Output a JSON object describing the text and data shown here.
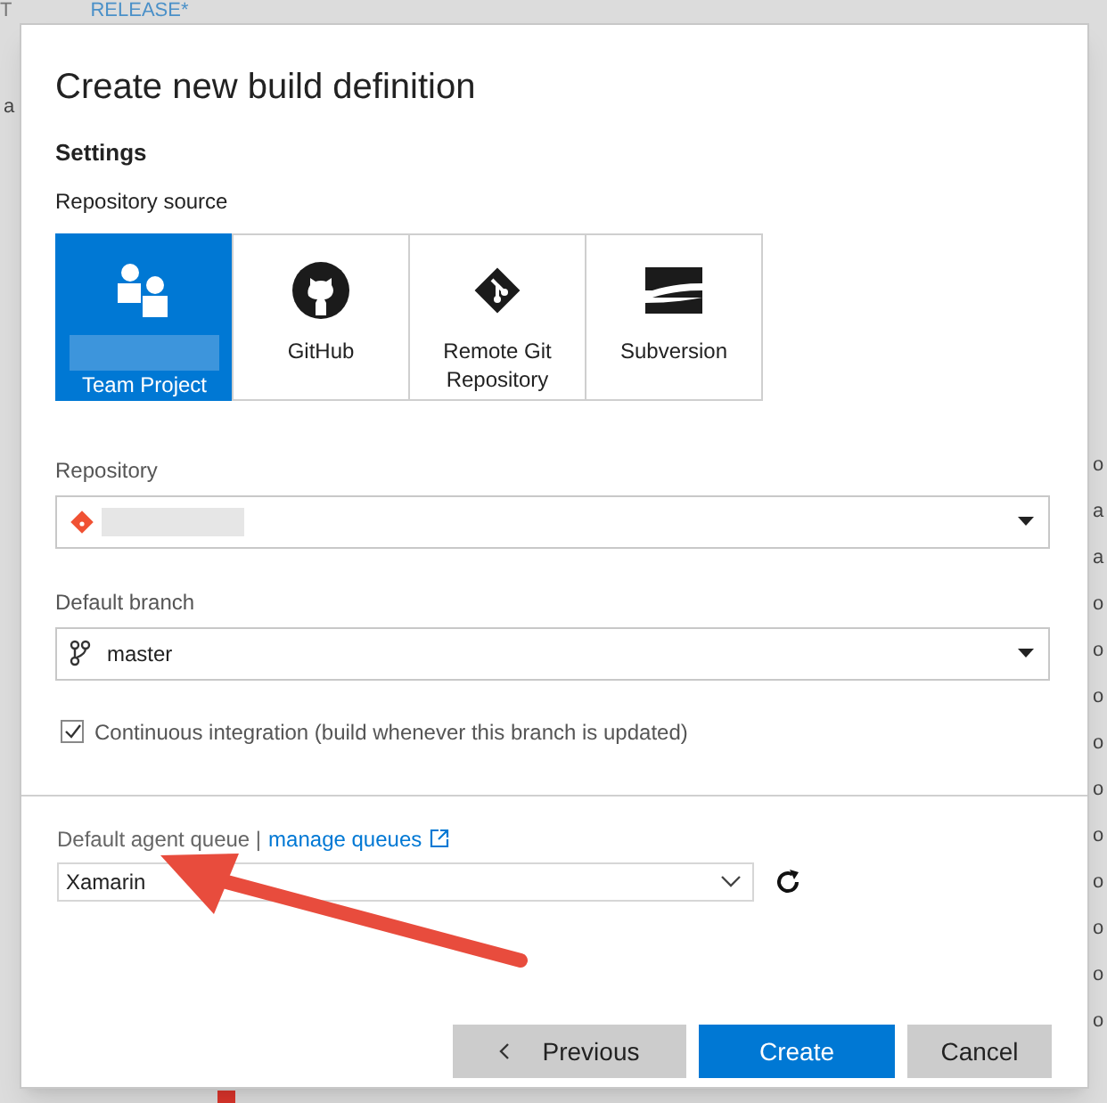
{
  "background": {
    "top_tabs": [
      "T",
      "RELEASE*"
    ],
    "left_fragment": "a",
    "right_fragments": [
      "o",
      "a",
      "a",
      "o",
      "o",
      "o",
      "o",
      "o",
      "o",
      "o",
      "o",
      "o",
      "o"
    ]
  },
  "dialog": {
    "title": "Create new build definition",
    "section": "Settings",
    "source_label": "Repository source",
    "sources": [
      {
        "kind": "team",
        "label": "Team Project",
        "selected": true
      },
      {
        "kind": "github",
        "label": "GitHub",
        "selected": false
      },
      {
        "kind": "git",
        "label": "Remote Git Repository",
        "selected": false
      },
      {
        "kind": "svn",
        "label": "Subversion",
        "selected": false
      }
    ],
    "repository": {
      "label": "Repository"
    },
    "branch": {
      "label": "Default branch",
      "value": "master"
    },
    "continuous_integration": {
      "label": "Continuous integration (build whenever this branch is updated)",
      "checked": true
    },
    "queue": {
      "label": "Default agent queue |",
      "link": "manage queues",
      "value": "Xamarin"
    },
    "buttons": [
      {
        "kind": "previous",
        "label": "Previous"
      },
      {
        "kind": "primary",
        "label": "Create"
      },
      {
        "kind": "secondary",
        "label": "Cancel"
      }
    ]
  }
}
